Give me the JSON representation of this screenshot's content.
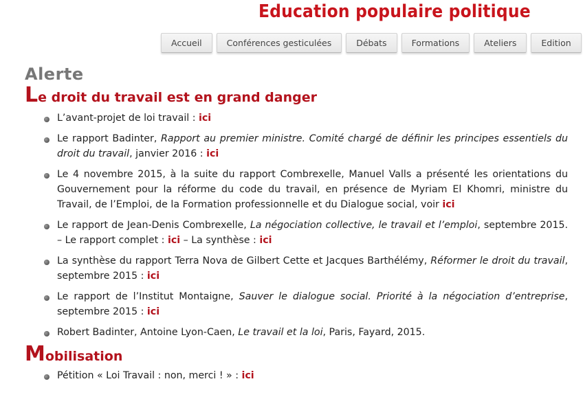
{
  "site": {
    "title": "Education populaire politique"
  },
  "nav": {
    "tabs": [
      "Accueil",
      "Conférences gesticulées",
      "Débats",
      "Formations",
      "Ateliers",
      "Edition"
    ]
  },
  "main": {
    "kicker": "Alerte",
    "section1": {
      "initial": "L",
      "rest": "e droit du travail est en grand danger",
      "items": [
        {
          "text": "L’avant-projet de loi travail : ",
          "link": "ici"
        },
        {
          "text": "Le rapport Badinter, ",
          "ital": "Rapport au premier ministre. Comité chargé de définir les principes essentiels du droit du travail",
          "text2": ", janvier 2016 : ",
          "link": "ici"
        },
        {
          "text": "Le 4 novembre 2015, à la suite du rapport Combrexelle, Manuel Valls a présenté les orientations du Gouvernement pour la réforme du code du travail, en présence de Myriam El Khomri, ministre du Travail, de l’Emploi, de la Formation professionnelle et du Dialogue social, voir ",
          "link": "ici"
        },
        {
          "text": "Le rapport de Jean-Denis Combrexelle, ",
          "ital": "La négociation collective, le travail et l’emploi",
          "text2": ", septembre 2015. – Le rapport complet : ",
          "link": "ici",
          "text3": " – La synthèse : ",
          "link2": "ici"
        },
        {
          "text": "La synthèse du rapport Terra Nova de Gilbert Cette et Jacques Barthélémy, ",
          "ital": "Réformer le droit du travail",
          "text2": ", septembre 2015 : ",
          "link": "ici"
        },
        {
          "text": "Le rapport de l’Institut Montaigne, ",
          "ital": "Sauver le dialogue social. Priorité à la négociation d’entreprise",
          "text2": ", septembre 2015 : ",
          "link": "ici"
        },
        {
          "text": "Robert Badinter, Antoine Lyon-Caen, ",
          "ital": "Le travail et la loi",
          "text2": ", Paris, Fayard, 2015."
        }
      ]
    },
    "section2": {
      "initial": "M",
      "rest": "obilisation",
      "items": [
        {
          "text": "Pétition « Loi Travail : non, merci ! » : ",
          "link": "ici"
        }
      ]
    }
  }
}
